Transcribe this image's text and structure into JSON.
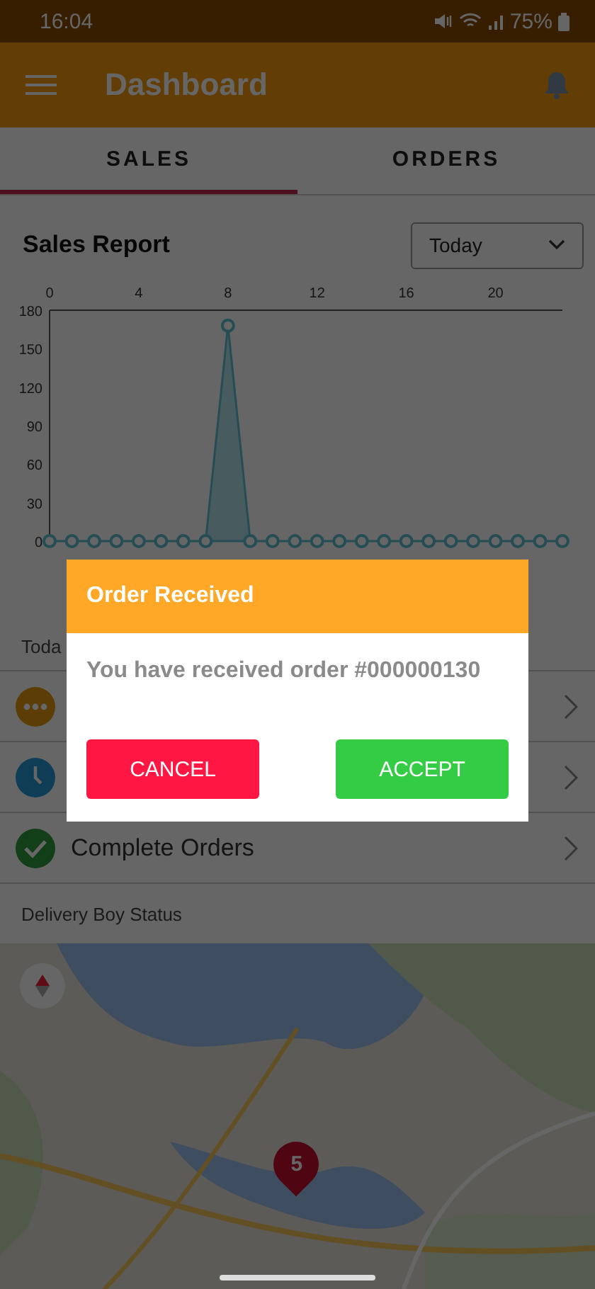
{
  "status_bar": {
    "time": "16:04",
    "battery": "75%"
  },
  "app_bar": {
    "title": "Dashboard"
  },
  "tabs": [
    {
      "label": "SALES",
      "selected": true
    },
    {
      "label": "ORDERS",
      "selected": false
    }
  ],
  "sales_report": {
    "title": "Sales Report",
    "period": "Today",
    "chart_data": {
      "type": "area",
      "x": [
        0,
        1,
        2,
        3,
        4,
        5,
        6,
        7,
        8,
        9,
        10,
        11,
        12,
        13,
        14,
        15,
        16,
        17,
        18,
        19,
        20,
        21,
        22,
        23
      ],
      "series": [
        {
          "color": "#5cc0d0",
          "values": [
            0,
            0,
            0,
            0,
            0,
            0,
            0,
            0,
            168,
            0,
            0,
            0,
            0,
            0,
            0,
            0,
            0,
            0,
            0,
            0,
            0,
            0,
            0,
            0
          ]
        }
      ],
      "xlim": [
        0,
        23
      ],
      "xticks": [
        0,
        4,
        8,
        12,
        16,
        20
      ],
      "yticks": [
        0,
        30,
        60,
        90,
        120,
        150,
        180
      ],
      "ylim": [
        0,
        180
      ]
    }
  },
  "orders_section": {
    "label": "Toda",
    "rows": [
      {
        "kind": "pending"
      },
      {
        "kind": "processing"
      },
      {
        "kind": "complete",
        "label": "Complete Orders"
      }
    ]
  },
  "delivery": {
    "label": "Delivery Boy Status",
    "pin": "5"
  },
  "dialog": {
    "title": "Order Received",
    "message": "You have received order #000000130",
    "buttons": [
      {
        "kind": "cancel",
        "label": "CANCEL"
      },
      {
        "kind": "accept",
        "label": "ACCEPT"
      }
    ]
  }
}
